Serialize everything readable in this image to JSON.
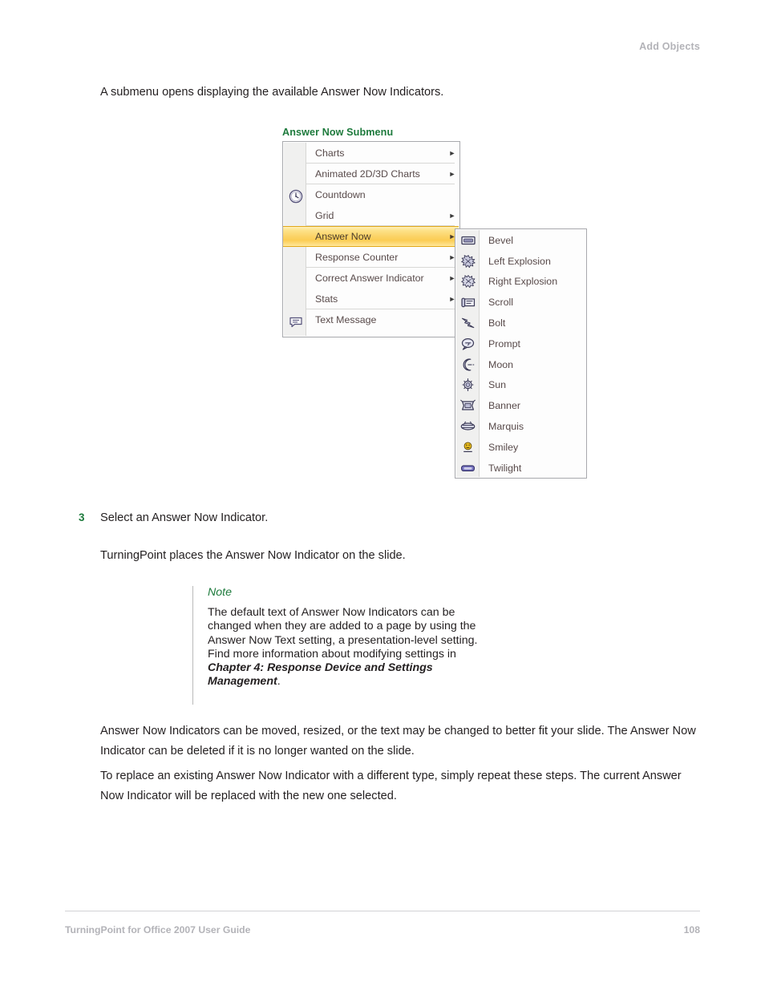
{
  "header": {
    "running_head": "Add Objects"
  },
  "intro": {
    "text": "A submenu opens displaying the available Answer Now Indicators."
  },
  "figure": {
    "caption": "Answer Now Submenu",
    "menu": {
      "items": [
        {
          "label": "Charts",
          "has_arrow": true,
          "icon": null,
          "separator_after": false,
          "highlighted": false
        },
        {
          "label": "Animated 2D/3D Charts",
          "has_arrow": true,
          "icon": null,
          "separator_after": true,
          "highlighted": false
        },
        {
          "label": "Countdown",
          "has_arrow": false,
          "icon": "clock-icon",
          "separator_after": false,
          "highlighted": false
        },
        {
          "label": "Grid",
          "has_arrow": true,
          "icon": null,
          "separator_after": true,
          "highlighted": false
        },
        {
          "label": "Answer Now",
          "has_arrow": true,
          "icon": null,
          "separator_after": false,
          "highlighted": true
        },
        {
          "label": "Response Counter",
          "has_arrow": true,
          "icon": null,
          "separator_after": true,
          "highlighted": false
        },
        {
          "label": "Correct Answer Indicator",
          "has_arrow": true,
          "icon": null,
          "separator_after": false,
          "highlighted": false
        },
        {
          "label": "Stats",
          "has_arrow": true,
          "icon": null,
          "separator_after": true,
          "highlighted": false
        },
        {
          "label": "Text Message",
          "has_arrow": false,
          "icon": "speech-bubble-icon",
          "separator_after": false,
          "highlighted": false
        }
      ]
    },
    "submenu": {
      "items": [
        {
          "label": "Bevel",
          "icon": "bevel-icon"
        },
        {
          "label": "Left Explosion",
          "icon": "left-explosion-icon"
        },
        {
          "label": "Right Explosion",
          "icon": "right-explosion-icon"
        },
        {
          "label": "Scroll",
          "icon": "scroll-icon"
        },
        {
          "label": "Bolt",
          "icon": "bolt-icon"
        },
        {
          "label": "Prompt",
          "icon": "prompt-icon"
        },
        {
          "label": "Moon",
          "icon": "moon-icon"
        },
        {
          "label": "Sun",
          "icon": "sun-icon"
        },
        {
          "label": "Banner",
          "icon": "banner-icon"
        },
        {
          "label": "Marquis",
          "icon": "marquis-icon"
        },
        {
          "label": "Smiley",
          "icon": "smiley-icon"
        },
        {
          "label": "Twilight",
          "icon": "twilight-icon"
        }
      ]
    }
  },
  "step": {
    "number": "3",
    "text": "Select an Answer Now Indicator.",
    "follow_text": "TurningPoint places the Answer Now Indicator on the slide."
  },
  "note": {
    "title": "Note",
    "body_before": "The default text of Answer Now Indicators can be changed when they are added to a page by using the Answer Now Text setting, a presentation-level setting. Find more information about modifying settings in ",
    "body_bold": "Chapter 4: Response Device and Settings Management",
    "body_after": "."
  },
  "paragraphs": {
    "p1": "Answer Now Indicators can be moved, resized, or the text may be changed to better fit your slide. The Answer Now Indicator can be deleted if it is no longer wanted on the slide.",
    "p2": "To replace an existing Answer Now Indicator with a different type, simply repeat these steps. The current Answer Now Indicator will be replaced with the new one selected."
  },
  "footer": {
    "left": "TurningPoint for Office 2007 User Guide",
    "page_number": "108"
  },
  "colors": {
    "accent_green": "#1d7a3c",
    "muted_gray": "#b3b3b8",
    "highlight_gold": "#fbd264",
    "menu_text": "#584a4a"
  }
}
